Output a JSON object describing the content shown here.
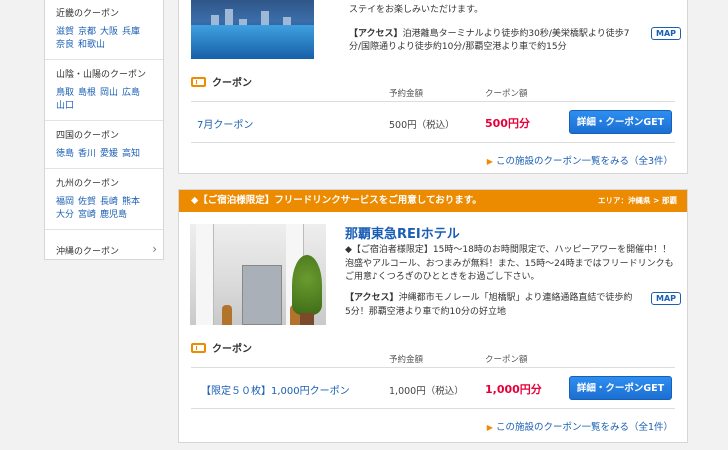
{
  "sidebar": {
    "regions": [
      {
        "title": "近畿のクーポン",
        "links": [
          "滋賀",
          "京都",
          "大阪",
          "兵庫",
          "奈良",
          "和歌山"
        ]
      },
      {
        "title": "山陰・山陽のクーポン",
        "links": [
          "鳥取",
          "島根",
          "岡山",
          "広島",
          "山口"
        ]
      },
      {
        "title": "四国のクーポン",
        "links": [
          "徳島",
          "香川",
          "愛媛",
          "高知"
        ]
      },
      {
        "title": "九州のクーポン",
        "links": [
          "福岡",
          "佐賀",
          "長崎",
          "熊本",
          "大分",
          "宮崎",
          "鹿児島"
        ]
      }
    ],
    "okinawa_label": "沖縄のクーポン"
  },
  "hotel1": {
    "desc_partial": "ステイをお楽しみいただけます。",
    "access_label": "【アクセス】",
    "access_text": "泊港離島ターミナルより徒歩約30秒/美栄橋駅より徒歩7分/国際通りより徒歩約10分/那覇空港より車で約15分",
    "map_label": "MAP",
    "coupon_heading": "クーポン",
    "col_price": "予約金額",
    "col_amount": "クーポン額",
    "coupon_name": "7月クーポン",
    "price": "500円（税込）",
    "amount": "500円分",
    "get_button": "詳細・クーポンGET",
    "more_link": "この施設のクーポン一覧をみる（全3件）"
  },
  "hotel2": {
    "banner": "◆【ご宿泊様限定】フリードリンクサービスをご用意しております。",
    "area": "エリア：沖縄県 > 那覇",
    "name": "那覇東急REIホテル",
    "desc": "◆【ご宿泊者様限定】15時～18時のお時間限定で、ハッピーアワーを開催中！！泡盛やアルコール、おつまみが無料！また、15時～24時まではフリードリンクもご用意♪くつろぎのひとときをお過ごし下さい。",
    "access_label": "【アクセス】",
    "access_text": "沖縄都市モノレール「旭橋駅」より連絡通路直結で徒歩約5分！那覇空港より車で約10分の好立地",
    "map_label": "MAP",
    "coupon_heading": "クーポン",
    "col_price": "予約金額",
    "col_amount": "クーポン額",
    "coupon_name": "【限定５０枚】1,000円クーポン",
    "price": "1,000円（税込）",
    "amount": "1,000円分",
    "get_button": "詳細・クーポンGET",
    "more_link": "この施設のクーポン一覧をみる（全1件）"
  },
  "colors": {
    "accent_orange": "#ec8a00",
    "link_blue": "#1a5fb4",
    "amount_red": "#e6003a",
    "button_blue": "#1c6fd1"
  }
}
